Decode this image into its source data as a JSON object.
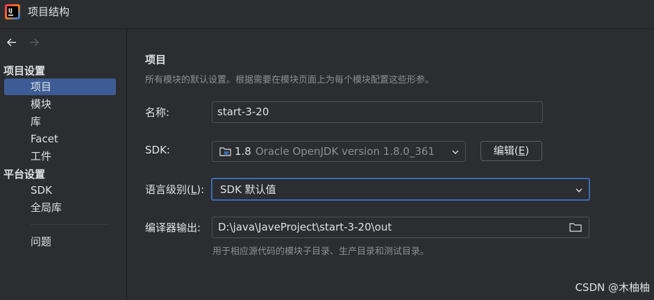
{
  "window": {
    "title": "项目结构"
  },
  "sidebar": {
    "project_settings_header": "项目设置",
    "project_settings_items": [
      {
        "label": "项目",
        "selected": true
      },
      {
        "label": "模块"
      },
      {
        "label": "库"
      },
      {
        "label": "Facet"
      },
      {
        "label": "工件"
      }
    ],
    "platform_settings_header": "平台设置",
    "platform_settings_items": [
      {
        "label": "SDK"
      },
      {
        "label": "全局库"
      }
    ],
    "problems_label": "问题"
  },
  "main": {
    "title": "项目",
    "description": "所有模块的默认设置。根据需要在模块页面上为每个模块配置这些形参。",
    "name_label": "名称:",
    "name_value": "start-3-20",
    "sdk_label": "SDK:",
    "sdk_version": "1.8",
    "sdk_detail": "Oracle OpenJDK version 1.8.0_361",
    "edit_button_prefix": "编辑(",
    "edit_button_mnemonic": "E",
    "edit_button_suffix": ")",
    "language_level_prefix": "语言级别(",
    "language_level_mnemonic": "L",
    "language_level_suffix": "):",
    "language_level_value": "SDK 默认值",
    "compiler_output_label": "编译器输出:",
    "compiler_output_value": "D:\\java\\JaveProject\\start-3-20\\out",
    "compiler_output_hint": "用于相应源代码的模块子目录、生产目录和测试目录。"
  },
  "watermark": "CSDN @木柚柚",
  "colors": {
    "background": "#2b2d30",
    "selection": "#3d5c95",
    "focus_border": "#3d6bb3",
    "muted_text": "#8c8f94"
  }
}
